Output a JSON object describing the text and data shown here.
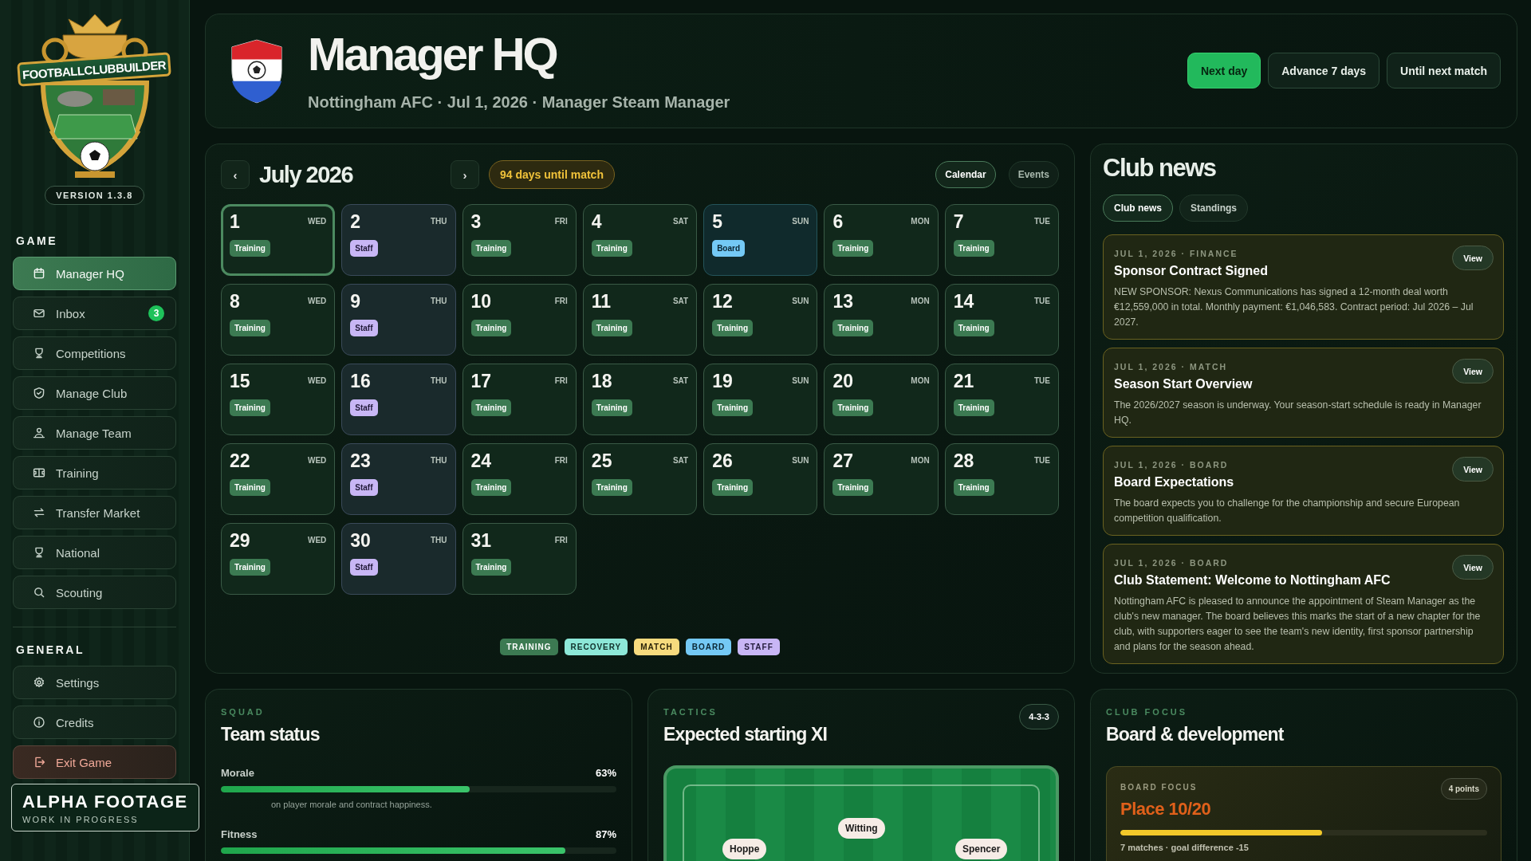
{
  "sidebar": {
    "logo_text": "FOOTBALLCLUBBUILDER",
    "version": "VERSION 1.3.8",
    "sections": [
      {
        "title": "GAME",
        "items": [
          {
            "label": "Manager HQ",
            "selected": true,
            "kind": "nav"
          },
          {
            "label": "Inbox",
            "selected": false,
            "kind": "nav",
            "badge": "3"
          },
          {
            "label": "Competitions",
            "selected": false,
            "kind": "nav"
          },
          {
            "label": "Manage Club",
            "selected": false,
            "kind": "nav"
          },
          {
            "label": "Manage Team",
            "selected": false,
            "kind": "nav"
          },
          {
            "label": "Training",
            "selected": false,
            "kind": "nav"
          },
          {
            "label": "Transfer Market",
            "selected": false,
            "kind": "nav"
          },
          {
            "label": "National",
            "selected": false,
            "kind": "nav"
          },
          {
            "label": "Scouting",
            "selected": false,
            "kind": "nav"
          }
        ]
      },
      {
        "title": "GENERAL",
        "items": [
          {
            "label": "Settings",
            "selected": false,
            "kind": "nav"
          },
          {
            "label": "Credits",
            "selected": false,
            "kind": "nav"
          },
          {
            "label": "Exit Game",
            "selected": false,
            "kind": "danger"
          }
        ]
      }
    ]
  },
  "overlay": {
    "title": "ALPHA FOOTAGE",
    "subtitle": "WORK IN PROGRESS"
  },
  "header": {
    "title": "Manager HQ",
    "subtitle": "Nottingham AFC · Jul 1, 2026 · Manager Steam Manager",
    "buttons": [
      {
        "label": "Next day",
        "kind": "primary"
      },
      {
        "label": "Advance 7 days",
        "kind": "secondary"
      },
      {
        "label": "Until next match",
        "kind": "secondary"
      }
    ]
  },
  "calendar": {
    "prev": "‹",
    "month": "July 2026",
    "next": "›",
    "countdown": "94 days until match",
    "views": [
      {
        "label": "Calendar",
        "selected": true
      },
      {
        "label": "Events",
        "selected": false
      }
    ],
    "days": [
      {
        "day": "1",
        "weekday": "WED",
        "event": "Training",
        "kind": "training",
        "selected": true
      },
      {
        "day": "2",
        "weekday": "THU",
        "event": "Staff",
        "kind": "staff",
        "selected": false
      },
      {
        "day": "3",
        "weekday": "FRI",
        "event": "Training",
        "kind": "training",
        "selected": false
      },
      {
        "day": "4",
        "weekday": "SAT",
        "event": "Training",
        "kind": "training",
        "selected": false
      },
      {
        "day": "5",
        "weekday": "SUN",
        "event": "Board",
        "kind": "board",
        "selected": false
      },
      {
        "day": "6",
        "weekday": "MON",
        "event": "Training",
        "kind": "training",
        "selected": false
      },
      {
        "day": "7",
        "weekday": "TUE",
        "event": "Training",
        "kind": "training",
        "selected": false
      },
      {
        "day": "8",
        "weekday": "WED",
        "event": "Training",
        "kind": "training",
        "selected": false
      },
      {
        "day": "9",
        "weekday": "THU",
        "event": "Staff",
        "kind": "staff",
        "selected": false
      },
      {
        "day": "10",
        "weekday": "FRI",
        "event": "Training",
        "kind": "training",
        "selected": false
      },
      {
        "day": "11",
        "weekday": "SAT",
        "event": "Training",
        "kind": "training",
        "selected": false
      },
      {
        "day": "12",
        "weekday": "SUN",
        "event": "Training",
        "kind": "training",
        "selected": false
      },
      {
        "day": "13",
        "weekday": "MON",
        "event": "Training",
        "kind": "training",
        "selected": false
      },
      {
        "day": "14",
        "weekday": "TUE",
        "event": "Training",
        "kind": "training",
        "selected": false
      },
      {
        "day": "15",
        "weekday": "WED",
        "event": "Training",
        "kind": "training",
        "selected": false
      },
      {
        "day": "16",
        "weekday": "THU",
        "event": "Staff",
        "kind": "staff",
        "selected": false
      },
      {
        "day": "17",
        "weekday": "FRI",
        "event": "Training",
        "kind": "training",
        "selected": false
      },
      {
        "day": "18",
        "weekday": "SAT",
        "event": "Training",
        "kind": "training",
        "selected": false
      },
      {
        "day": "19",
        "weekday": "SUN",
        "event": "Training",
        "kind": "training",
        "selected": false
      },
      {
        "day": "20",
        "weekday": "MON",
        "event": "Training",
        "kind": "training",
        "selected": false
      },
      {
        "day": "21",
        "weekday": "TUE",
        "event": "Training",
        "kind": "training",
        "selected": false
      },
      {
        "day": "22",
        "weekday": "WED",
        "event": "Training",
        "kind": "training",
        "selected": false
      },
      {
        "day": "23",
        "weekday": "THU",
        "event": "Staff",
        "kind": "staff",
        "selected": false
      },
      {
        "day": "24",
        "weekday": "FRI",
        "event": "Training",
        "kind": "training",
        "selected": false
      },
      {
        "day": "25",
        "weekday": "SAT",
        "event": "Training",
        "kind": "training",
        "selected": false
      },
      {
        "day": "26",
        "weekday": "SUN",
        "event": "Training",
        "kind": "training",
        "selected": false
      },
      {
        "day": "27",
        "weekday": "MON",
        "event": "Training",
        "kind": "training",
        "selected": false
      },
      {
        "day": "28",
        "weekday": "TUE",
        "event": "Training",
        "kind": "training",
        "selected": false
      },
      {
        "day": "29",
        "weekday": "WED",
        "event": "Training",
        "kind": "training",
        "selected": false
      },
      {
        "day": "30",
        "weekday": "THU",
        "event": "Staff",
        "kind": "staff",
        "selected": false
      },
      {
        "day": "31",
        "weekday": "FRI",
        "event": "Training",
        "kind": "training",
        "selected": false
      }
    ],
    "legend": [
      {
        "label": "TRAINING",
        "kind": "training"
      },
      {
        "label": "RECOVERY",
        "kind": "recovery"
      },
      {
        "label": "MATCH",
        "kind": "match"
      },
      {
        "label": "BOARD",
        "kind": "board"
      },
      {
        "label": "STAFF",
        "kind": "staff"
      }
    ]
  },
  "news": {
    "title": "Club news",
    "tabs": [
      {
        "label": "Club news",
        "selected": true
      },
      {
        "label": "Standings",
        "selected": false
      }
    ],
    "items": [
      {
        "meta": "JUL 1, 2026 · FINANCE",
        "title": "Sponsor Contract Signed",
        "body": "NEW SPONSOR: Nexus Communications has signed a 12-month deal worth €12,559,000 in total. Monthly payment: €1,046,583. Contract period: Jul 2026 – Jul 2027.",
        "action": "View"
      },
      {
        "meta": "JUL 1, 2026 · MATCH",
        "title": "Season Start Overview",
        "body": "The 2026/2027 season is underway. Your season-start schedule is ready in Manager HQ.",
        "action": "View"
      },
      {
        "meta": "JUL 1, 2026 · BOARD",
        "title": "Board Expectations",
        "body": "The board expects you to challenge for the championship and secure European competition qualification.",
        "action": "View"
      },
      {
        "meta": "JUL 1, 2026 · BOARD",
        "title": "Club Statement: Welcome to Nottingham AFC",
        "body": "Nottingham AFC is pleased to announce the appointment of Steam Manager as the club's new manager. The board believes this marks the start of a new chapter for the club, with supporters eager to see the team's new identity, first sponsor partnership and plans for the season ahead.",
        "action": "View"
      }
    ]
  },
  "squad": {
    "eyebrow": "SQUAD",
    "title": "Team status",
    "metrics": [
      {
        "label": "Morale",
        "reading": "63%",
        "level": 0.63,
        "note": "on player morale and contract happiness."
      },
      {
        "label": "Fitness",
        "reading": "87%",
        "level": 0.87
      }
    ]
  },
  "tactics": {
    "eyebrow": "TACTICS",
    "title": "Expected starting XI",
    "formation": "4-3-3",
    "players": [
      {
        "name": "Witting"
      },
      {
        "name": "Hoppe"
      },
      {
        "name": "Spencer"
      }
    ]
  },
  "focus": {
    "eyebrow": "CLUB FOCUS",
    "title": "Board & development",
    "card": {
      "label": "BOARD FOCUS",
      "badge": "4 points",
      "value": "Place 10/20",
      "level": 0.55,
      "note": "7 matches · goal difference -15"
    }
  }
}
